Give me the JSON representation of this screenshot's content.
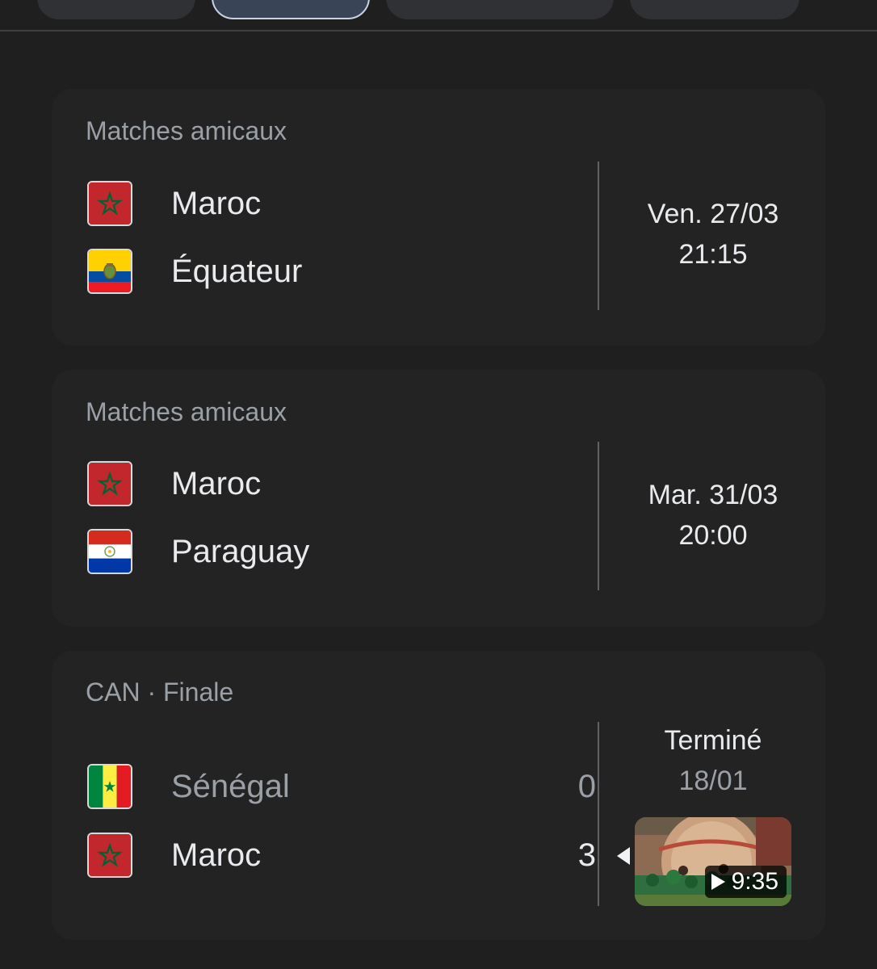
{
  "colors": {
    "background": "#1f1f1f",
    "card": "#232323",
    "text_primary": "#e8eaed",
    "text_secondary": "#9aa0a6",
    "active_tab_border": "#c7d2e6"
  },
  "tabs": [
    {
      "label": "",
      "active": false
    },
    {
      "label": "",
      "active": true
    },
    {
      "label": "",
      "active": false
    },
    {
      "label": "",
      "active": false
    }
  ],
  "matches": [
    {
      "competition": "Matches amicaux",
      "teams": [
        {
          "name": "Maroc",
          "flag": "morocco-flag-icon"
        },
        {
          "name": "Équateur",
          "flag": "ecuador-flag-icon"
        }
      ],
      "date": "Ven. 27/03",
      "time": "21:15"
    },
    {
      "competition": "Matches amicaux",
      "teams": [
        {
          "name": "Maroc",
          "flag": "morocco-flag-icon"
        },
        {
          "name": "Paraguay",
          "flag": "paraguay-flag-icon"
        }
      ],
      "date": "Mar. 31/03",
      "time": "20:00"
    },
    {
      "competition": "CAN · Finale",
      "teams": [
        {
          "name": "Sénégal",
          "flag": "senegal-flag-icon",
          "score": "0"
        },
        {
          "name": "Maroc",
          "flag": "morocco-flag-icon",
          "score": "3",
          "winner": true
        }
      ],
      "status": "Terminé",
      "date": "18/01",
      "video": {
        "duration": "9:35",
        "icon": "play-icon"
      }
    }
  ]
}
